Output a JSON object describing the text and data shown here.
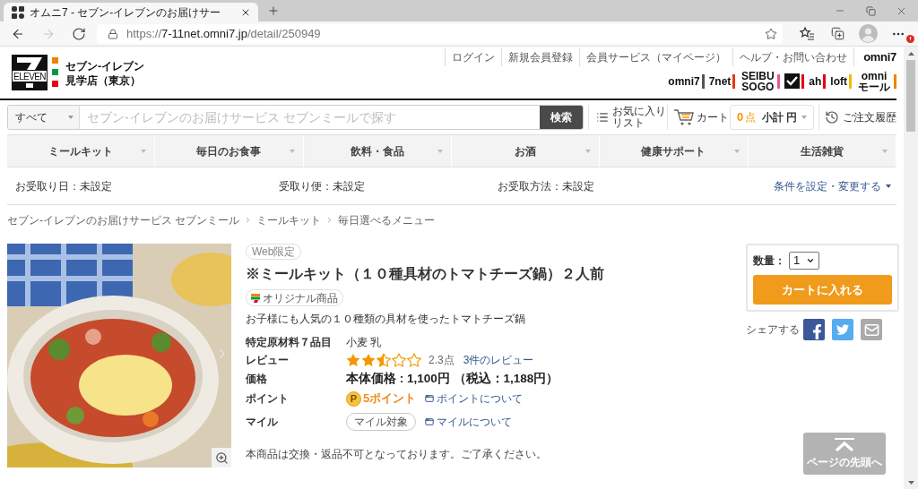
{
  "browser": {
    "tabs": [
      {
        "title": "オムニ7 - セブン-イレブンのお届けサー",
        "selected": true
      }
    ],
    "nav_buttons": [
      {
        "kind": "back",
        "disabled": false
      },
      {
        "kind": "forward",
        "disabled": true
      },
      {
        "kind": "refresh",
        "disabled": false
      }
    ],
    "url": {
      "scheme": "https://",
      "host": "7-11net.omni7.jp",
      "path": "/detail/250949"
    }
  },
  "header": {
    "logo_text": "ELEVEN",
    "store_name": "セブン-イレブン",
    "store_branch": "見学店（東京）",
    "top_links": [
      "ログイン",
      "新規会員登録",
      "会員サービス（マイページ）",
      "ヘルプ・お問い合わせ"
    ],
    "brand": "omni7",
    "brand_logos": [
      {
        "kind": "text",
        "label": "omni7",
        "color": "#555555"
      },
      {
        "kind": "text",
        "label": "7net",
        "color": "#e8380d"
      },
      {
        "kind": "text",
        "label": "SEIBU SOGO",
        "color": "#e9559a"
      },
      {
        "kind": "mark",
        "color": "#e60012"
      },
      {
        "kind": "text",
        "label": "ah",
        "color": "#e60012"
      },
      {
        "kind": "text",
        "label": "loft",
        "color": "#f5b700"
      },
      {
        "kind": "text",
        "label": "omni モール",
        "color": "#f08300"
      }
    ]
  },
  "search": {
    "category": "すべて",
    "placeholder": "セブン-イレブンのお届けサービス セブンミールで探す",
    "button": "検索"
  },
  "toolbar": {
    "favorites": [
      "お気に入り",
      "リスト"
    ],
    "cart": "カート",
    "cart_count": "0",
    "cart_count_unit": "点",
    "subtotal_label": "小計",
    "subtotal_unit": "円",
    "history": "ご注文履歴"
  },
  "categories": [
    "ミールキット",
    "毎日のお食事",
    "飲料・食品",
    "お酒",
    "健康サポート",
    "生活雑貨"
  ],
  "delivery": {
    "conditions": [
      "お受取り日：未設定",
      "受取り便：未設定",
      "お受取方法：未設定"
    ],
    "change_link": "条件を設定・変更する"
  },
  "breadcrumb": [
    "セブン-イレブンのお届けサービス セブンミール",
    "ミールキット",
    "毎日選べるメニュー"
  ],
  "product": {
    "badge": "Web限定",
    "title": "※ミールキット（１０種具材のトマトチーズ鍋）２人前",
    "original_badge": "オリジナル商品",
    "description": "お子様にも人気の１０種類の具材を使ったトマトチーズ鍋",
    "specs": [
      {
        "kind": "text",
        "label": "特定原材料７品目",
        "value": "小麦 乳"
      },
      {
        "kind": "review",
        "label": "レビュー",
        "stars": 2.5,
        "score": "2.3点",
        "link": "3件のレビュー"
      },
      {
        "kind": "price",
        "label": "価格",
        "value": "本体価格 : 1,100円 （税込：1,188円）"
      },
      {
        "kind": "points",
        "label": "ポイント",
        "coin": "P",
        "value": "5ポイント",
        "link": "ポイントについて"
      },
      {
        "kind": "miles",
        "label": "マイル",
        "badge": "マイル対象",
        "link": "マイルについて"
      }
    ],
    "notice": "本商品は交換・返品不可となっております。ご了承ください。"
  },
  "purchase": {
    "quantity_label": "数量：",
    "quantity": "1",
    "add_button": "カートに入れる"
  },
  "share": {
    "label": "シェアする",
    "services": [
      {
        "kind": "facebook",
        "color": "#3b5998"
      },
      {
        "kind": "twitter",
        "color": "#55acee"
      },
      {
        "kind": "mail",
        "color": "#aaaaaa"
      }
    ]
  },
  "back_to_top": {
    "label": "ページの先頭へ"
  }
}
